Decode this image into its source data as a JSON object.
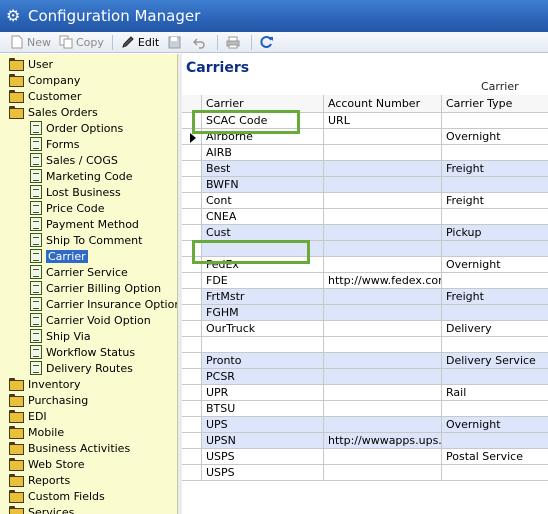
{
  "window": {
    "title": "Configuration Manager"
  },
  "toolbar": {
    "new_label": "New",
    "copy_label": "Copy",
    "edit_label": "Edit"
  },
  "tree": {
    "items": [
      {
        "label": "User",
        "type": "folder",
        "level": 0
      },
      {
        "label": "Company",
        "type": "folder",
        "level": 0
      },
      {
        "label": "Customer",
        "type": "folder",
        "level": 0
      },
      {
        "label": "Sales Orders",
        "type": "folder-open",
        "level": 0
      },
      {
        "label": "Order Options",
        "type": "doc",
        "level": 1
      },
      {
        "label": "Forms",
        "type": "doc",
        "level": 1
      },
      {
        "label": "Sales / COGS",
        "type": "doc",
        "level": 1
      },
      {
        "label": "Marketing Code",
        "type": "doc",
        "level": 1
      },
      {
        "label": "Lost Business",
        "type": "doc",
        "level": 1
      },
      {
        "label": "Price Code",
        "type": "doc",
        "level": 1
      },
      {
        "label": "Payment Method",
        "type": "doc",
        "level": 1
      },
      {
        "label": "Ship To Comment",
        "type": "doc",
        "level": 1
      },
      {
        "label": "Carrier",
        "type": "doc",
        "level": 1,
        "selected": true
      },
      {
        "label": "Carrier Service",
        "type": "doc",
        "level": 1
      },
      {
        "label": "Carrier Billing Option",
        "type": "doc",
        "level": 1
      },
      {
        "label": "Carrier Insurance Option",
        "type": "doc",
        "level": 1
      },
      {
        "label": "Carrier Void Option",
        "type": "doc",
        "level": 1
      },
      {
        "label": "Ship Via",
        "type": "doc",
        "level": 1
      },
      {
        "label": "Workflow Status",
        "type": "doc",
        "level": 1
      },
      {
        "label": "Delivery Routes",
        "type": "doc",
        "level": 1
      },
      {
        "label": "Inventory",
        "type": "folder",
        "level": 0
      },
      {
        "label": "Purchasing",
        "type": "folder",
        "level": 0
      },
      {
        "label": "EDI",
        "type": "folder",
        "level": 0
      },
      {
        "label": "Mobile",
        "type": "folder",
        "level": 0
      },
      {
        "label": "Business Activities",
        "type": "folder",
        "level": 0
      },
      {
        "label": "Web Store",
        "type": "folder",
        "level": 0
      },
      {
        "label": "Reports",
        "type": "folder",
        "level": 0
      },
      {
        "label": "Custom Fields",
        "type": "folder",
        "level": 0
      },
      {
        "label": "Services",
        "type": "folder",
        "level": 0
      }
    ]
  },
  "content": {
    "heading": "Carriers",
    "band_label": "Carrier",
    "columns": [
      "Carrier",
      "Account Number",
      "Carrier Type"
    ],
    "rows": [
      {
        "carrier": "SCAC Code",
        "account": "URL",
        "type": "",
        "alt": false,
        "pointer": false
      },
      {
        "carrier": "Airborne",
        "account": "",
        "type": "Overnight",
        "alt": false,
        "pointer": true
      },
      {
        "carrier": "AIRB",
        "account": "",
        "type": "",
        "alt": false,
        "pointer": false
      },
      {
        "carrier": "Best",
        "account": "",
        "type": "Freight",
        "alt": true,
        "pointer": false
      },
      {
        "carrier": "BWFN",
        "account": "",
        "type": "",
        "alt": true,
        "pointer": false
      },
      {
        "carrier": "Cont",
        "account": "",
        "type": "Freight",
        "alt": false,
        "pointer": false
      },
      {
        "carrier": "CNEA",
        "account": "",
        "type": "",
        "alt": false,
        "pointer": false
      },
      {
        "carrier": "Cust",
        "account": "",
        "type": "Pickup",
        "alt": true,
        "pointer": false
      },
      {
        "carrier": "",
        "account": "",
        "type": "",
        "alt": true,
        "pointer": false
      },
      {
        "carrier": "FedEx",
        "account": "",
        "type": "Overnight",
        "alt": false,
        "pointer": false
      },
      {
        "carrier": "FDE",
        "account": "http://www.fedex.com/Tracking?action=track",
        "type": "",
        "alt": false,
        "pointer": false
      },
      {
        "carrier": "FrtMstr",
        "account": "",
        "type": "Freight",
        "alt": true,
        "pointer": false
      },
      {
        "carrier": "FGHM",
        "account": "",
        "type": "",
        "alt": true,
        "pointer": false
      },
      {
        "carrier": "OurTruck",
        "account": "",
        "type": "Delivery",
        "alt": false,
        "pointer": false
      },
      {
        "carrier": "",
        "account": "",
        "type": "",
        "alt": false,
        "pointer": false
      },
      {
        "carrier": "Pronto",
        "account": "",
        "type": "Delivery Service",
        "alt": true,
        "pointer": false
      },
      {
        "carrier": "PCSR",
        "account": "",
        "type": "",
        "alt": true,
        "pointer": false
      },
      {
        "carrier": "UPR",
        "account": "",
        "type": "Rail",
        "alt": false,
        "pointer": false
      },
      {
        "carrier": "BTSU",
        "account": "",
        "type": "",
        "alt": false,
        "pointer": false
      },
      {
        "carrier": "UPS",
        "account": "",
        "type": "Overnight",
        "alt": true,
        "pointer": false
      },
      {
        "carrier": "UPSN",
        "account": "http://wwwapps.ups.com/etracking/tracking.c",
        "type": "",
        "alt": true,
        "pointer": false
      },
      {
        "carrier": "USPS",
        "account": "",
        "type": "Postal Service",
        "alt": false,
        "pointer": false
      },
      {
        "carrier": "USPS",
        "account": "",
        "type": "",
        "alt": false,
        "pointer": false
      }
    ]
  },
  "colors": {
    "title_bar": "#2a64b8",
    "tree_bg": "#fbfbd0",
    "alt_row": "#dde5fa",
    "highlight_box": "#6aaa3a",
    "heading": "#0c2f83"
  }
}
